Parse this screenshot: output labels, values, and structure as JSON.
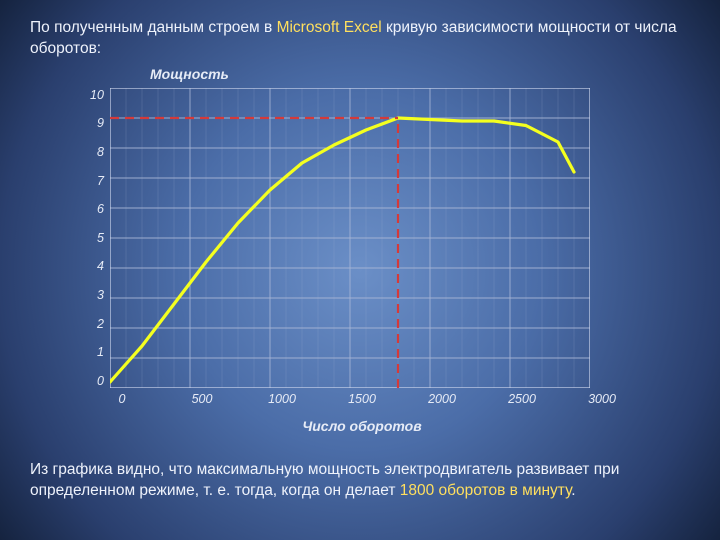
{
  "intro": {
    "pre": "По полученным данным строем в ",
    "excel": "Microsoft Excel",
    "post": " кривую зависимости мощности от числа оборотов:"
  },
  "outro": {
    "pre": "Из графика видно, что максимальную мощность электродвигатель развивает при определенном режиме, т. е. тогда, когда он делает ",
    "hl": "1800 оборотов в минуту",
    "post": "."
  },
  "chart_data": {
    "type": "line",
    "title": "",
    "ylabel": "Мощность",
    "xlabel": "Число оборотов",
    "xlim": [
      0,
      3000
    ],
    "ylim": [
      0,
      10
    ],
    "x_ticks": [
      0,
      500,
      1000,
      1500,
      2000,
      2500,
      3000
    ],
    "y_ticks": [
      0,
      1,
      2,
      3,
      4,
      5,
      6,
      7,
      8,
      9,
      10
    ],
    "grid": true,
    "series": [
      {
        "name": "Мощность",
        "color": "#f4ff1f",
        "x": [
          0,
          200,
          400,
          600,
          800,
          1000,
          1200,
          1400,
          1600,
          1800,
          2000,
          2200,
          2400,
          2600,
          2800,
          2900
        ],
        "values": [
          0.2,
          1.4,
          2.8,
          4.2,
          5.5,
          6.6,
          7.5,
          8.1,
          8.6,
          9.0,
          8.95,
          8.9,
          8.9,
          8.75,
          8.2,
          7.2
        ]
      }
    ],
    "marker": {
      "x": 1800,
      "y": 9.0,
      "color": "#d43a3a"
    }
  }
}
